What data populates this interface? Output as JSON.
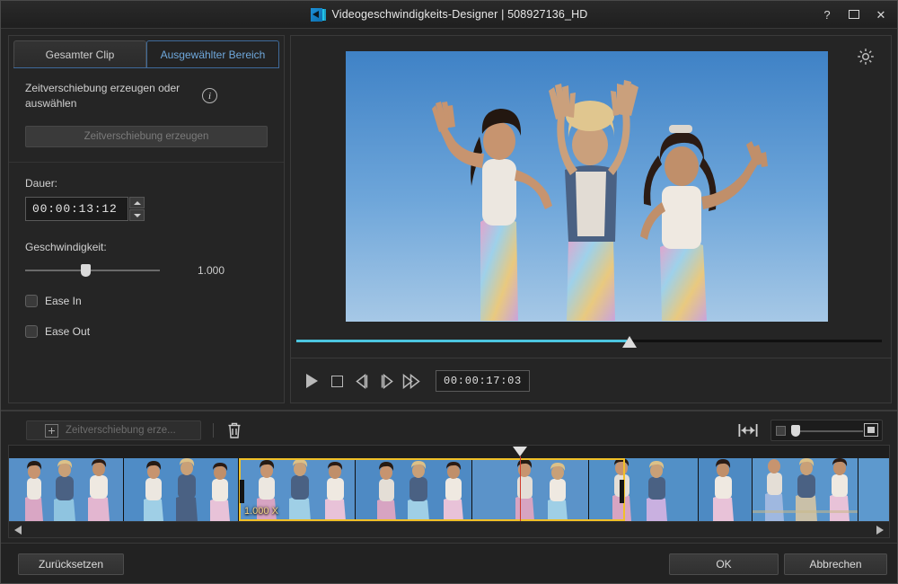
{
  "window": {
    "title": "Videogeschwindigkeits-Designer  |  508927136_HD",
    "app_icon": "video-speed-icon",
    "help_label": "?",
    "maximize_label": "maximize-icon",
    "close_label": "✕"
  },
  "left_panel": {
    "tabs": [
      {
        "label": "Gesamter Clip",
        "active": false
      },
      {
        "label": "Ausgewählter Bereich",
        "active": true
      }
    ],
    "timeshift": {
      "description": "Zeitverschiebung erzeugen oder auswählen",
      "info_icon": "info-icon",
      "button_label": "Zeitverschiebung erzeugen",
      "button_enabled": false
    },
    "duration": {
      "label": "Dauer:",
      "value": "00:00:13:12"
    },
    "speed": {
      "label": "Geschwindigkeit:",
      "value": "1.000",
      "slider_percent": 41
    },
    "ease_in": {
      "label": "Ease In",
      "checked": false
    },
    "ease_out": {
      "label": "Ease Out",
      "checked": false
    }
  },
  "preview": {
    "scrubber_percent": 56,
    "timecode": "00:00:17:03",
    "controls": [
      {
        "name": "play-button",
        "icon": "play-icon"
      },
      {
        "name": "stop-button",
        "icon": "stop-icon"
      },
      {
        "name": "previous-frame-button",
        "icon": "previous-frame-icon"
      },
      {
        "name": "next-frame-button",
        "icon": "next-frame-icon"
      },
      {
        "name": "fast-forward-button",
        "icon": "fast-forward-icon"
      }
    ],
    "settings_icon": "gear-icon"
  },
  "timeline": {
    "toolbar": {
      "add_button_label": "Zeitverschiebung erze...",
      "add_icon": "plus-icon",
      "delete_icon": "trash-icon",
      "fit_icon": "fit-to-window-icon",
      "zoom_out_icon": "zoom-out-icon",
      "zoom_in_icon": "zoom-in-icon",
      "zoom_percent": 5
    },
    "selection": {
      "speed_label": "1.000 X",
      "accent_color": "#f0c028"
    },
    "playhead_percent": 58,
    "scroll_left_icon": "scroll-left-arrow",
    "scroll_right_icon": "scroll-right-arrow"
  },
  "footer": {
    "reset_label": "Zurücksetzen",
    "ok_label": "OK",
    "cancel_label": "Abbrechen"
  },
  "colors": {
    "accent_blue": "#4cc6e0",
    "tab_active": "#6fa8dc",
    "selection_yellow": "#f0c028",
    "playhead_red": "#cf3a2c"
  }
}
